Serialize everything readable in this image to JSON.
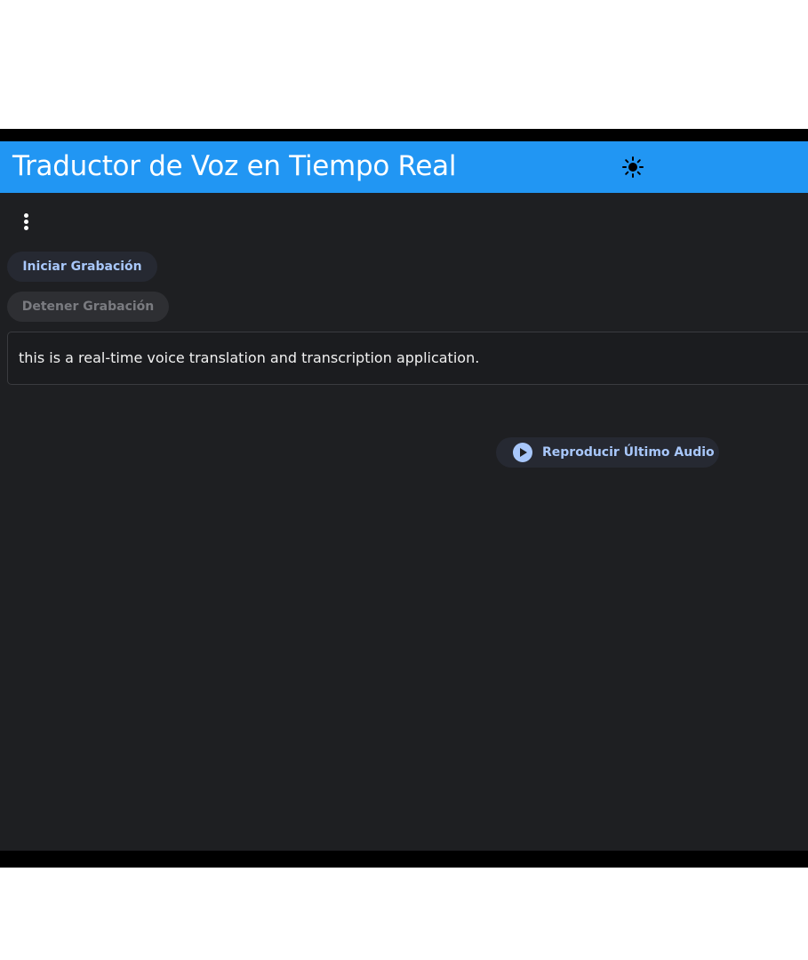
{
  "app": {
    "title": "Traductor de Voz en Tiempo Real",
    "theme_toggle_icon": "sun-icon"
  },
  "menu": {
    "icon": "more-vertical-icon"
  },
  "controls": {
    "start_label": "Iniciar Grabación",
    "stop_label": "Detener Grabación",
    "stop_disabled": true
  },
  "transcript": {
    "text": "this is a real-time voice translation and transcription application."
  },
  "playback": {
    "icon": "play-circle-icon",
    "label": "Reproducir Último Audio"
  },
  "colors": {
    "appbar": "#2196f3",
    "background": "#1e1f22",
    "accent": "#a8c7fa"
  }
}
